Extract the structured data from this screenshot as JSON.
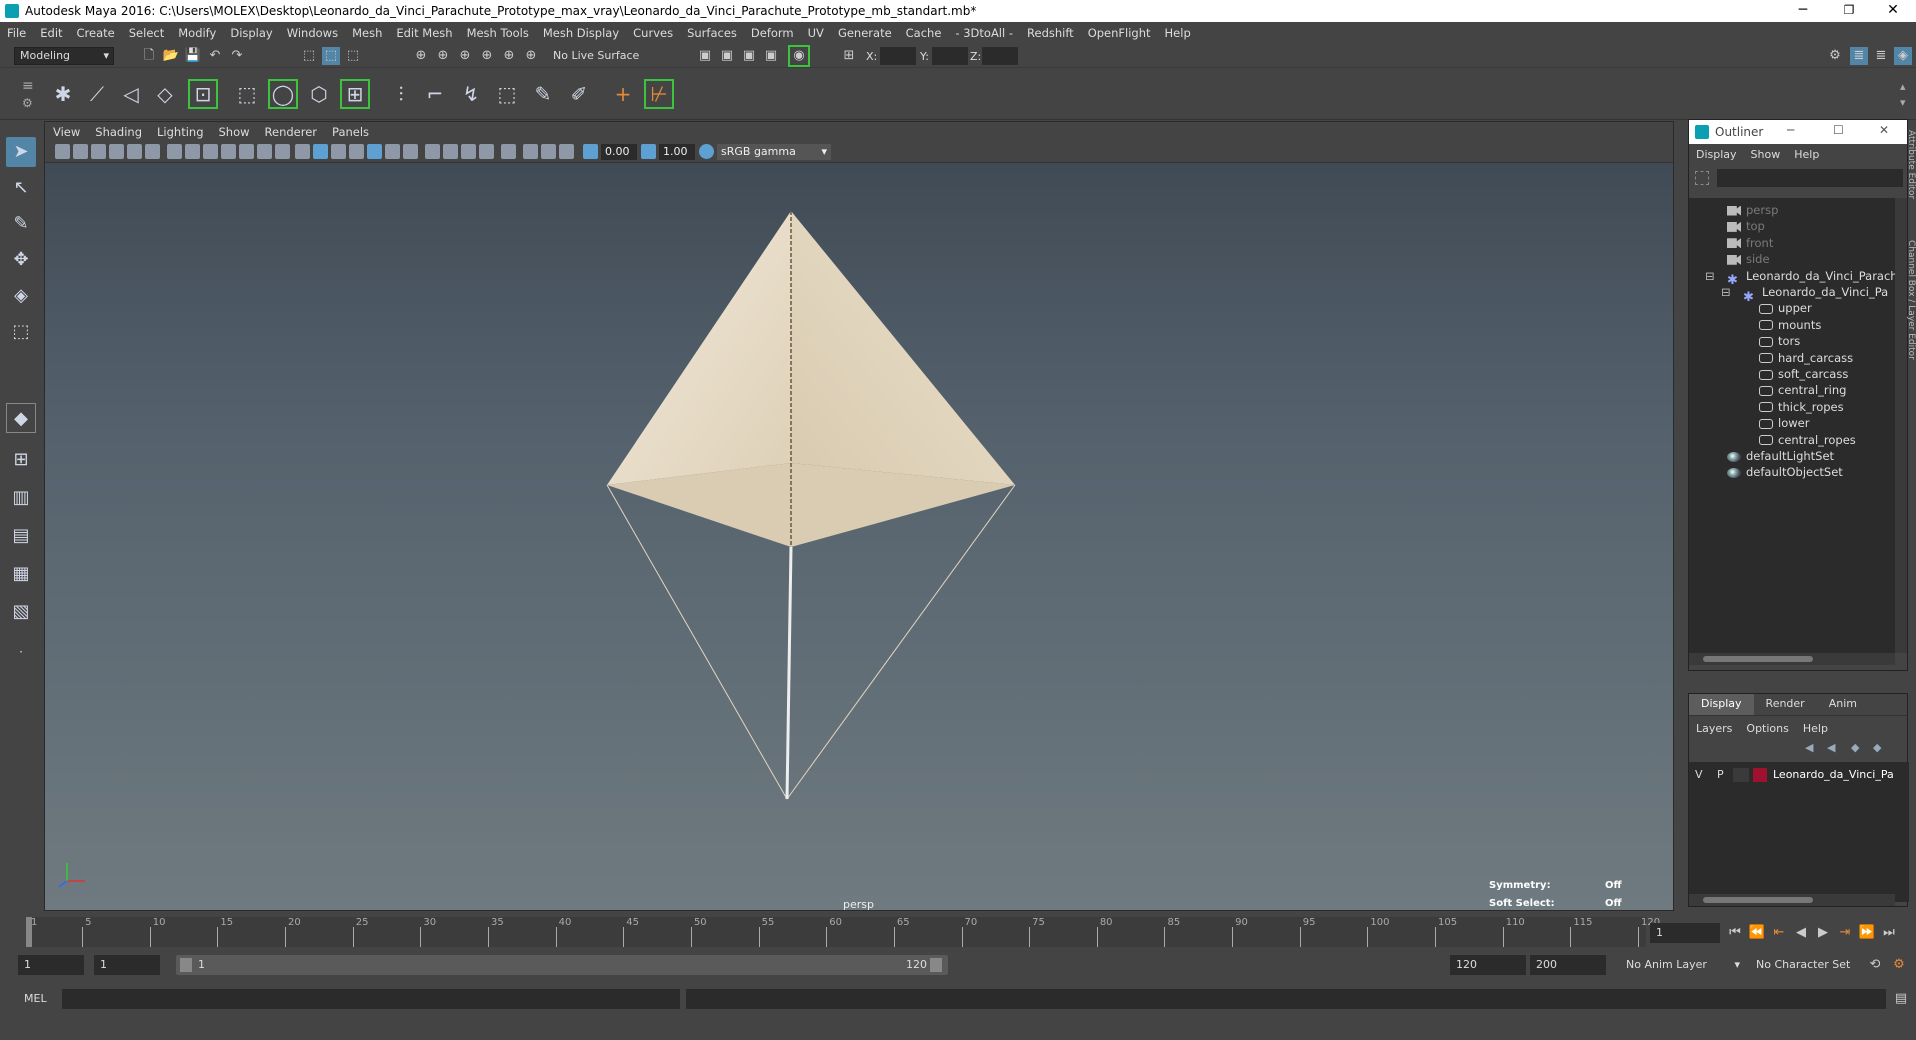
{
  "window": {
    "title": "Autodesk Maya 2016: C:\\Users\\MOLEX\\Desktop\\Leonardo_da_Vinci_Parachute_Prototype_max_vray\\Leonardo_da_Vinci_Parachute_Prototype_mb_standart.mb*",
    "minimize": "─",
    "restore": "❐",
    "close": "✕"
  },
  "menubar": [
    "File",
    "Edit",
    "Create",
    "Select",
    "Modify",
    "Display",
    "Windows",
    "Mesh",
    "Edit Mesh",
    "Mesh Tools",
    "Mesh Display",
    "Curves",
    "Surfaces",
    "Deform",
    "UV",
    "Generate",
    "Cache",
    "- 3DtoAll -",
    "Redshift",
    "OpenFlight",
    "Help"
  ],
  "status": {
    "mode": "Modeling",
    "live_surface": "No Live Surface",
    "x_label": "X:",
    "y_label": "Y:",
    "z_label": "Z:"
  },
  "viewport": {
    "menu": [
      "View",
      "Shading",
      "Lighting",
      "Show",
      "Renderer",
      "Panels"
    ],
    "exposure": "0.00",
    "gamma": "1.00",
    "color_space": "sRGB gamma",
    "camera_label": "persp",
    "symmetry_label": "Symmetry:",
    "symmetry_value": "Off",
    "soft_select_label": "Soft Select:",
    "soft_select_value": "Off"
  },
  "outliner": {
    "title": "Outliner",
    "menu": [
      "Display",
      "Show",
      "Help"
    ],
    "items": [
      {
        "label": "persp",
        "type": "camera"
      },
      {
        "label": "top",
        "type": "camera"
      },
      {
        "label": "front",
        "type": "camera"
      },
      {
        "label": "side",
        "type": "camera"
      },
      {
        "label": "Leonardo_da_Vinci_Parach",
        "type": "group"
      },
      {
        "label": "Leonardo_da_Vinci_Pa",
        "type": "group"
      },
      {
        "label": "upper",
        "type": "mesh"
      },
      {
        "label": "mounts",
        "type": "mesh"
      },
      {
        "label": "tors",
        "type": "mesh"
      },
      {
        "label": "hard_carcass",
        "type": "mesh"
      },
      {
        "label": "soft_carcass",
        "type": "mesh"
      },
      {
        "label": "central_ring",
        "type": "mesh"
      },
      {
        "label": "thick_ropes",
        "type": "mesh"
      },
      {
        "label": "lower",
        "type": "mesh"
      },
      {
        "label": "central_ropes",
        "type": "mesh"
      },
      {
        "label": "defaultLightSet",
        "type": "set"
      },
      {
        "label": "defaultObjectSet",
        "type": "set"
      }
    ]
  },
  "layer_editor": {
    "tabs": [
      "Display",
      "Render",
      "Anim"
    ],
    "menu": [
      "Layers",
      "Options",
      "Help"
    ],
    "layer": {
      "v": "V",
      "p": "P",
      "name": "Leonardo_da_Vinci_Pa",
      "color": "#a01030"
    }
  },
  "side_tabs": [
    "Attribute Editor",
    "Channel Box / Layer Editor"
  ],
  "timeline": {
    "ticks": [
      "1",
      "5",
      "10",
      "15",
      "20",
      "25",
      "30",
      "35",
      "40",
      "45",
      "50",
      "55",
      "60",
      "65",
      "70",
      "75",
      "80",
      "85",
      "90",
      "95",
      "100",
      "105",
      "110",
      "115",
      "120"
    ],
    "current_frame": "1"
  },
  "range": {
    "start": "1",
    "playback_start": "1",
    "slider_start": "1",
    "slider_end": "120",
    "playback_end": "120",
    "end": "200",
    "anim_layer": "No Anim Layer",
    "character_set": "No Character Set"
  },
  "command": {
    "label": "MEL"
  }
}
